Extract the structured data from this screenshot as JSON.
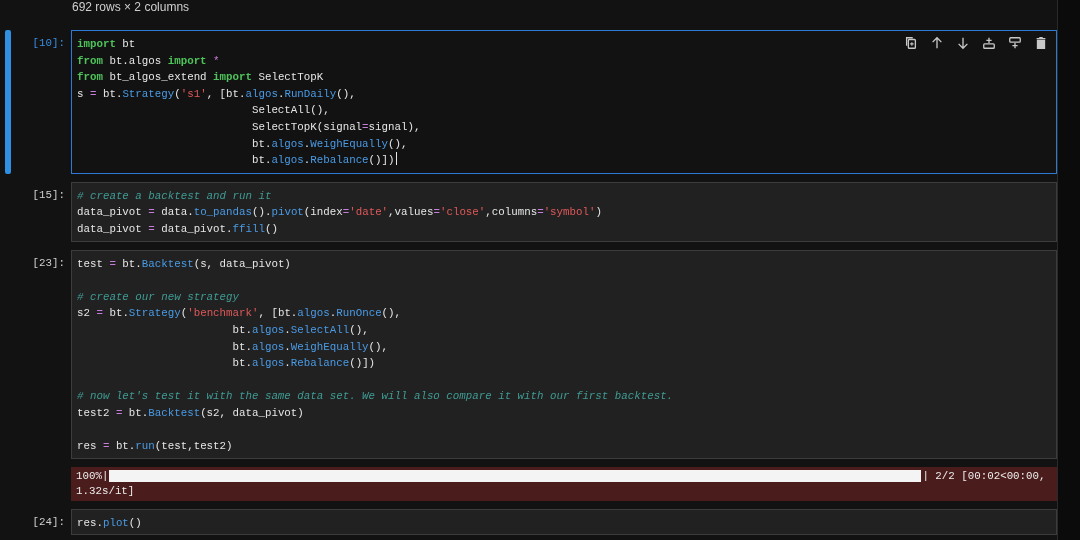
{
  "previous_output": {
    "summary": "692 rows × 2 columns"
  },
  "cells": [
    {
      "prompt": "[10]:",
      "selected": true,
      "editing": true,
      "lines": [
        {
          "tokens": [
            {
              "kind": "kw",
              "text": "import"
            },
            {
              "kind": "plain",
              "text": " bt"
            }
          ]
        },
        {
          "tokens": [
            {
              "kind": "kw",
              "text": "from"
            },
            {
              "kind": "plain",
              "text": " bt.algos "
            },
            {
              "kind": "kw",
              "text": "import"
            },
            {
              "kind": "op",
              "text": " *"
            }
          ]
        },
        {
          "tokens": [
            {
              "kind": "kw",
              "text": "from"
            },
            {
              "kind": "plain",
              "text": " bt_algos_extend "
            },
            {
              "kind": "kw",
              "text": "import"
            },
            {
              "kind": "plain",
              "text": " SelectTopK"
            }
          ]
        },
        {
          "tokens": [
            {
              "kind": "plain",
              "text": "s "
            },
            {
              "kind": "op",
              "text": "="
            },
            {
              "kind": "plain",
              "text": " bt."
            },
            {
              "kind": "fn",
              "text": "Strategy"
            },
            {
              "kind": "plain",
              "text": "("
            },
            {
              "kind": "str",
              "text": "'s1'"
            },
            {
              "kind": "plain",
              "text": ", [bt."
            },
            {
              "kind": "fn",
              "text": "algos"
            },
            {
              "kind": "plain",
              "text": "."
            },
            {
              "kind": "fn",
              "text": "RunDaily"
            },
            {
              "kind": "plain",
              "text": "(),"
            }
          ]
        },
        {
          "tokens": [
            {
              "kind": "plain",
              "text": "                           SelectAll(),"
            }
          ]
        },
        {
          "tokens": [
            {
              "kind": "plain",
              "text": "                           SelectTopK(signal"
            },
            {
              "kind": "op",
              "text": "="
            },
            {
              "kind": "plain",
              "text": "signal),"
            }
          ]
        },
        {
          "tokens": [
            {
              "kind": "plain",
              "text": "                           bt."
            },
            {
              "kind": "fn",
              "text": "algos"
            },
            {
              "kind": "plain",
              "text": "."
            },
            {
              "kind": "fn",
              "text": "WeighEqually"
            },
            {
              "kind": "plain",
              "text": "(),"
            }
          ]
        },
        {
          "tokens": [
            {
              "kind": "plain",
              "text": "                           bt."
            },
            {
              "kind": "fn",
              "text": "algos"
            },
            {
              "kind": "plain",
              "text": "."
            },
            {
              "kind": "fn",
              "text": "Rebalance"
            },
            {
              "kind": "plain",
              "text": "()])"
            }
          ]
        }
      ]
    },
    {
      "prompt": "[15]:",
      "selected": false,
      "editing": false,
      "lines": [
        {
          "tokens": [
            {
              "kind": "cm",
              "text": "# create a backtest and run it"
            }
          ]
        },
        {
          "tokens": [
            {
              "kind": "plain",
              "text": "data_pivot "
            },
            {
              "kind": "op",
              "text": "="
            },
            {
              "kind": "plain",
              "text": " data."
            },
            {
              "kind": "fn",
              "text": "to_pandas"
            },
            {
              "kind": "plain",
              "text": "()."
            },
            {
              "kind": "fn",
              "text": "pivot"
            },
            {
              "kind": "plain",
              "text": "(index"
            },
            {
              "kind": "op",
              "text": "="
            },
            {
              "kind": "str",
              "text": "'date'"
            },
            {
              "kind": "plain",
              "text": ",values"
            },
            {
              "kind": "op",
              "text": "="
            },
            {
              "kind": "str",
              "text": "'close'"
            },
            {
              "kind": "plain",
              "text": ",columns"
            },
            {
              "kind": "op",
              "text": "="
            },
            {
              "kind": "str",
              "text": "'symbol'"
            },
            {
              "kind": "plain",
              "text": ")"
            }
          ]
        },
        {
          "tokens": [
            {
              "kind": "plain",
              "text": "data_pivot "
            },
            {
              "kind": "op",
              "text": "="
            },
            {
              "kind": "plain",
              "text": " data_pivot."
            },
            {
              "kind": "fn",
              "text": "ffill"
            },
            {
              "kind": "plain",
              "text": "()"
            }
          ]
        }
      ]
    },
    {
      "prompt": "[23]:",
      "selected": false,
      "editing": false,
      "lines": [
        {
          "tokens": [
            {
              "kind": "plain",
              "text": "test "
            },
            {
              "kind": "op",
              "text": "="
            },
            {
              "kind": "plain",
              "text": " bt."
            },
            {
              "kind": "fn",
              "text": "Backtest"
            },
            {
              "kind": "plain",
              "text": "(s, data_pivot)"
            }
          ]
        },
        {
          "blank_before": true,
          "tokens": [
            {
              "kind": "cm",
              "text": "# create our new strategy"
            }
          ]
        },
        {
          "tokens": [
            {
              "kind": "plain",
              "text": "s2 "
            },
            {
              "kind": "op",
              "text": "="
            },
            {
              "kind": "plain",
              "text": " bt."
            },
            {
              "kind": "fn",
              "text": "Strategy"
            },
            {
              "kind": "plain",
              "text": "("
            },
            {
              "kind": "str",
              "text": "'benchmark'"
            },
            {
              "kind": "plain",
              "text": ", [bt."
            },
            {
              "kind": "fn",
              "text": "algos"
            },
            {
              "kind": "plain",
              "text": "."
            },
            {
              "kind": "fn",
              "text": "RunOnce"
            },
            {
              "kind": "plain",
              "text": "(),"
            }
          ]
        },
        {
          "tokens": [
            {
              "kind": "plain",
              "text": "                        bt."
            },
            {
              "kind": "fn",
              "text": "algos"
            },
            {
              "kind": "plain",
              "text": "."
            },
            {
              "kind": "fn",
              "text": "SelectAll"
            },
            {
              "kind": "plain",
              "text": "(),"
            }
          ]
        },
        {
          "tokens": [
            {
              "kind": "plain",
              "text": "                        bt."
            },
            {
              "kind": "fn",
              "text": "algos"
            },
            {
              "kind": "plain",
              "text": "."
            },
            {
              "kind": "fn",
              "text": "WeighEqually"
            },
            {
              "kind": "plain",
              "text": "(),"
            }
          ]
        },
        {
          "tokens": [
            {
              "kind": "plain",
              "text": "                        bt."
            },
            {
              "kind": "fn",
              "text": "algos"
            },
            {
              "kind": "plain",
              "text": "."
            },
            {
              "kind": "fn",
              "text": "Rebalance"
            },
            {
              "kind": "plain",
              "text": "()])"
            }
          ]
        },
        {
          "blank_before": true,
          "tokens": [
            {
              "kind": "cm",
              "text": "# now let's test it with the same data set. We will also compare it with our first backtest."
            }
          ]
        },
        {
          "tokens": [
            {
              "kind": "plain",
              "text": "test2 "
            },
            {
              "kind": "op",
              "text": "="
            },
            {
              "kind": "plain",
              "text": " bt."
            },
            {
              "kind": "fn",
              "text": "Backtest"
            },
            {
              "kind": "plain",
              "text": "(s2, data_pivot)"
            }
          ]
        },
        {
          "blank_before": true,
          "tokens": [
            {
              "kind": "plain",
              "text": "res "
            },
            {
              "kind": "op",
              "text": "="
            },
            {
              "kind": "plain",
              "text": " bt."
            },
            {
              "kind": "fn",
              "text": "run"
            },
            {
              "kind": "plain",
              "text": "(test,test2)"
            }
          ]
        }
      ],
      "output": {
        "percent": "100%|",
        "level": 1,
        "status": "| 2/2 [00:02<00:00,",
        "rate": "1.32s/it]"
      }
    },
    {
      "prompt": "[24]:",
      "selected": false,
      "editing": false,
      "lines": [
        {
          "tokens": [
            {
              "kind": "plain",
              "text": "res."
            },
            {
              "kind": "fn",
              "text": "plot"
            },
            {
              "kind": "plain",
              "text": "()"
            }
          ]
        }
      ]
    }
  ]
}
